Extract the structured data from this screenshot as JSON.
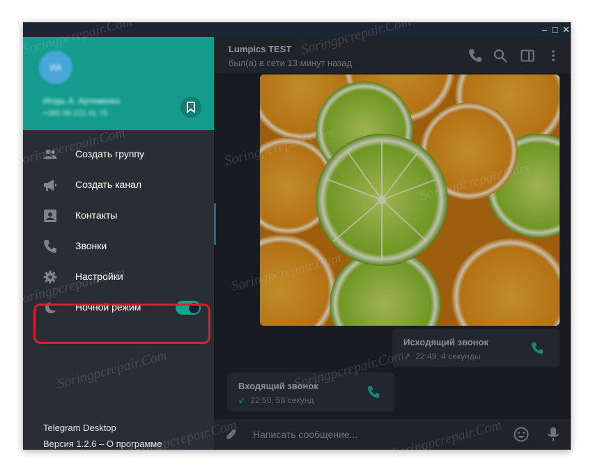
{
  "window": {
    "controls": {
      "minimize": "–",
      "maximize": "□",
      "close": "✕"
    }
  },
  "sidebar": {
    "header": {
      "avatar_initials": "ИА",
      "user_name": "Игорь А. Артеменко",
      "user_phone": "+380 99 221 41 75",
      "saved_icon": "bookmark-icon",
      "bg_color": "#149b8c"
    },
    "menu": [
      {
        "label": "Создать группу",
        "icon": "group-icon"
      },
      {
        "label": "Создать канал",
        "icon": "megaphone-icon"
      },
      {
        "label": "Контакты",
        "icon": "contacts-icon"
      },
      {
        "label": "Звонки",
        "icon": "phone-icon"
      },
      {
        "label": "Настройки",
        "icon": "gear-icon"
      },
      {
        "label": "Ночной режим",
        "icon": "moon-icon",
        "toggle_on": true
      }
    ],
    "footer": {
      "app_name": "Telegram Desktop",
      "version": "Версия 1.2.6 – О программе"
    }
  },
  "chat": {
    "title": "Lumpics TEST",
    "status": "был(а) в сети 13 минут назад",
    "header_icons": [
      "phone-icon",
      "search-icon",
      "sidebar-toggle-icon",
      "more-icon"
    ],
    "messages": {
      "outgoing_call": {
        "title": "Исходящий звонок",
        "details": "22:49, 4 секунды",
        "arrow": "↗"
      },
      "incoming_call": {
        "title": "Входящий звонок",
        "details": "22:50, 58 секунд",
        "arrow": "↙"
      }
    },
    "composer": {
      "placeholder": "Написать сообщение..."
    }
  },
  "watermark_text": "Soringpcrepair.Com",
  "colors": {
    "accent": "#17a294",
    "highlight_border": "#d7202d",
    "sidebar_bg": "#282e33",
    "chat_bg": "#181c20"
  }
}
